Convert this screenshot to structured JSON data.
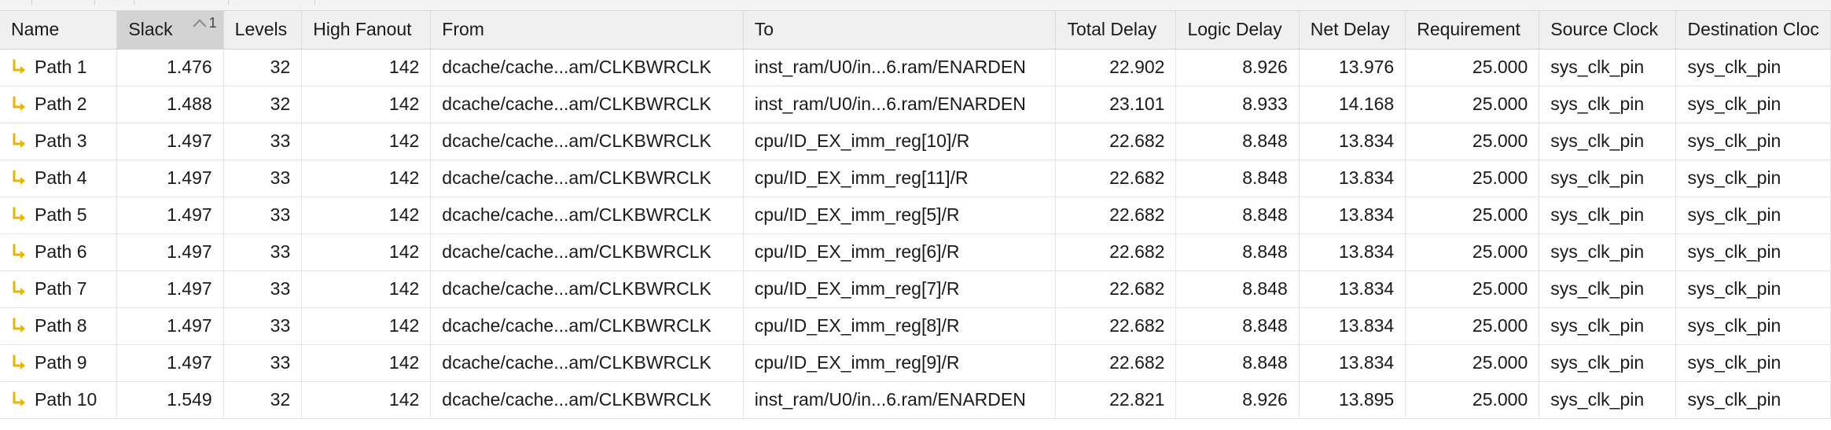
{
  "columns": [
    {
      "key": "name",
      "label": "Name"
    },
    {
      "key": "slack",
      "label": "Slack",
      "sorted": true,
      "sort_order": "1"
    },
    {
      "key": "levels",
      "label": "Levels"
    },
    {
      "key": "high_fanout",
      "label": "High Fanout"
    },
    {
      "key": "from",
      "label": "From"
    },
    {
      "key": "to",
      "label": "To"
    },
    {
      "key": "total_delay",
      "label": "Total Delay"
    },
    {
      "key": "logic_delay",
      "label": "Logic Delay"
    },
    {
      "key": "net_delay",
      "label": "Net Delay"
    },
    {
      "key": "requirement",
      "label": "Requirement"
    },
    {
      "key": "source_clock",
      "label": "Source Clock"
    },
    {
      "key": "destination_clock",
      "label": "Destination Cloc"
    }
  ],
  "rows": [
    {
      "name": "Path 1",
      "slack": "1.476",
      "levels": "32",
      "high_fanout": "142",
      "from": "dcache/cache...am/CLKBWRCLK",
      "to": "inst_ram/U0/in...6.ram/ENARDEN",
      "total_delay": "22.902",
      "logic_delay": "8.926",
      "net_delay": "13.976",
      "requirement": "25.000",
      "source_clock": "sys_clk_pin",
      "destination_clock": "sys_clk_pin"
    },
    {
      "name": "Path 2",
      "slack": "1.488",
      "levels": "32",
      "high_fanout": "142",
      "from": "dcache/cache...am/CLKBWRCLK",
      "to": "inst_ram/U0/in...6.ram/ENARDEN",
      "total_delay": "23.101",
      "logic_delay": "8.933",
      "net_delay": "14.168",
      "requirement": "25.000",
      "source_clock": "sys_clk_pin",
      "destination_clock": "sys_clk_pin"
    },
    {
      "name": "Path 3",
      "slack": "1.497",
      "levels": "33",
      "high_fanout": "142",
      "from": "dcache/cache...am/CLKBWRCLK",
      "to": "cpu/ID_EX_imm_reg[10]/R",
      "total_delay": "22.682",
      "logic_delay": "8.848",
      "net_delay": "13.834",
      "requirement": "25.000",
      "source_clock": "sys_clk_pin",
      "destination_clock": "sys_clk_pin"
    },
    {
      "name": "Path 4",
      "slack": "1.497",
      "levels": "33",
      "high_fanout": "142",
      "from": "dcache/cache...am/CLKBWRCLK",
      "to": "cpu/ID_EX_imm_reg[11]/R",
      "total_delay": "22.682",
      "logic_delay": "8.848",
      "net_delay": "13.834",
      "requirement": "25.000",
      "source_clock": "sys_clk_pin",
      "destination_clock": "sys_clk_pin"
    },
    {
      "name": "Path 5",
      "slack": "1.497",
      "levels": "33",
      "high_fanout": "142",
      "from": "dcache/cache...am/CLKBWRCLK",
      "to": "cpu/ID_EX_imm_reg[5]/R",
      "total_delay": "22.682",
      "logic_delay": "8.848",
      "net_delay": "13.834",
      "requirement": "25.000",
      "source_clock": "sys_clk_pin",
      "destination_clock": "sys_clk_pin"
    },
    {
      "name": "Path 6",
      "slack": "1.497",
      "levels": "33",
      "high_fanout": "142",
      "from": "dcache/cache...am/CLKBWRCLK",
      "to": "cpu/ID_EX_imm_reg[6]/R",
      "total_delay": "22.682",
      "logic_delay": "8.848",
      "net_delay": "13.834",
      "requirement": "25.000",
      "source_clock": "sys_clk_pin",
      "destination_clock": "sys_clk_pin"
    },
    {
      "name": "Path 7",
      "slack": "1.497",
      "levels": "33",
      "high_fanout": "142",
      "from": "dcache/cache...am/CLKBWRCLK",
      "to": "cpu/ID_EX_imm_reg[7]/R",
      "total_delay": "22.682",
      "logic_delay": "8.848",
      "net_delay": "13.834",
      "requirement": "25.000",
      "source_clock": "sys_clk_pin",
      "destination_clock": "sys_clk_pin"
    },
    {
      "name": "Path 8",
      "slack": "1.497",
      "levels": "33",
      "high_fanout": "142",
      "from": "dcache/cache...am/CLKBWRCLK",
      "to": "cpu/ID_EX_imm_reg[8]/R",
      "total_delay": "22.682",
      "logic_delay": "8.848",
      "net_delay": "13.834",
      "requirement": "25.000",
      "source_clock": "sys_clk_pin",
      "destination_clock": "sys_clk_pin"
    },
    {
      "name": "Path 9",
      "slack": "1.497",
      "levels": "33",
      "high_fanout": "142",
      "from": "dcache/cache...am/CLKBWRCLK",
      "to": "cpu/ID_EX_imm_reg[9]/R",
      "total_delay": "22.682",
      "logic_delay": "8.848",
      "net_delay": "13.834",
      "requirement": "25.000",
      "source_clock": "sys_clk_pin",
      "destination_clock": "sys_clk_pin"
    },
    {
      "name": "Path 10",
      "slack": "1.549",
      "levels": "32",
      "high_fanout": "142",
      "from": "dcache/cache...am/CLKBWRCLK",
      "to": "inst_ram/U0/in...6.ram/ENARDEN",
      "total_delay": "22.821",
      "logic_delay": "8.926",
      "net_delay": "13.895",
      "requirement": "25.000",
      "source_clock": "sys_clk_pin",
      "destination_clock": "sys_clk_pin"
    }
  ],
  "icons": {
    "row_icon": "timing-path-arrow-icon",
    "sort_icon": "sort-ascending-caret-icon"
  },
  "colors": {
    "path_icon": "#e8b400",
    "sorted_header": "#d3d3d3",
    "header_bg": "#f0f0f0"
  }
}
